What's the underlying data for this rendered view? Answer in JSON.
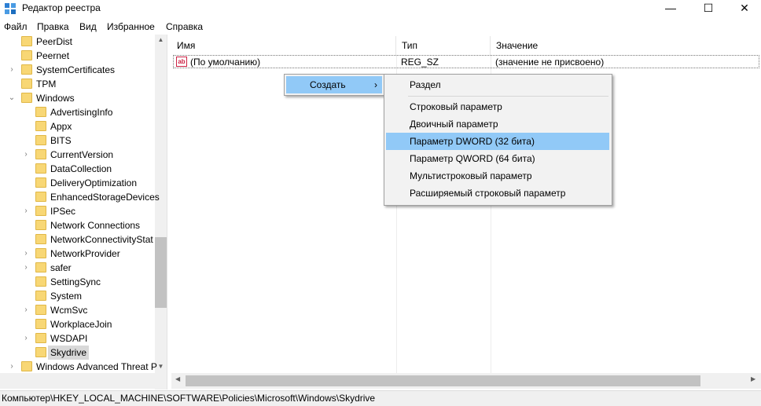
{
  "window": {
    "title": "Редактор реестра",
    "minimize": "—",
    "maximize": "☐",
    "close": "✕"
  },
  "menu": [
    "Файл",
    "Правка",
    "Вид",
    "Избранное",
    "Справка"
  ],
  "tree": [
    {
      "label": "PeerDist",
      "level": 1,
      "expandable": false
    },
    {
      "label": "Peernet",
      "level": 1,
      "expandable": false
    },
    {
      "label": "SystemCertificates",
      "level": 1,
      "expandable": true
    },
    {
      "label": "TPM",
      "level": 1,
      "expandable": false
    },
    {
      "label": "Windows",
      "level": 1,
      "expandable": true,
      "expanded": true
    },
    {
      "label": "AdvertisingInfo",
      "level": 2,
      "expandable": false
    },
    {
      "label": "Appx",
      "level": 2,
      "expandable": false
    },
    {
      "label": "BITS",
      "level": 2,
      "expandable": false
    },
    {
      "label": "CurrentVersion",
      "level": 2,
      "expandable": true
    },
    {
      "label": "DataCollection",
      "level": 2,
      "expandable": false
    },
    {
      "label": "DeliveryOptimization",
      "level": 2,
      "expandable": false
    },
    {
      "label": "EnhancedStorageDevices",
      "level": 2,
      "expandable": false
    },
    {
      "label": "IPSec",
      "level": 2,
      "expandable": true
    },
    {
      "label": "Network Connections",
      "level": 2,
      "expandable": false
    },
    {
      "label": "NetworkConnectivityStat",
      "level": 2,
      "expandable": false
    },
    {
      "label": "NetworkProvider",
      "level": 2,
      "expandable": true
    },
    {
      "label": "safer",
      "level": 2,
      "expandable": true
    },
    {
      "label": "SettingSync",
      "level": 2,
      "expandable": false
    },
    {
      "label": "System",
      "level": 2,
      "expandable": false
    },
    {
      "label": "WcmSvc",
      "level": 2,
      "expandable": true
    },
    {
      "label": "WorkplaceJoin",
      "level": 2,
      "expandable": false
    },
    {
      "label": "WSDAPI",
      "level": 2,
      "expandable": true
    },
    {
      "label": "Skydrive",
      "level": 2,
      "expandable": false,
      "selected": true
    },
    {
      "label": "Windows Advanced Threat P",
      "level": 1,
      "expandable": true
    }
  ],
  "list": {
    "columns": [
      "Имя",
      "Тип",
      "Значение"
    ],
    "rows": [
      {
        "name": "(По умолчанию)",
        "type": "REG_SZ",
        "value": "(значение не присвоено)"
      }
    ]
  },
  "context_menu": {
    "label": "Создать",
    "arrow": "›"
  },
  "submenu": {
    "key_item": "Раздел",
    "items": [
      "Строковый параметр",
      "Двоичный параметр",
      "Параметр DWORD (32 бита)",
      "Параметр QWORD (64 бита)",
      "Мультистроковый параметр",
      "Расширяемый строковый параметр"
    ],
    "highlighted_index": 2
  },
  "status": "Компьютер\\HKEY_LOCAL_MACHINE\\SOFTWARE\\Policies\\Microsoft\\Windows\\Skydrive",
  "colors": {
    "folder": "#f8d775",
    "highlight": "#91c9f7",
    "selection": "#d9d9d9"
  }
}
